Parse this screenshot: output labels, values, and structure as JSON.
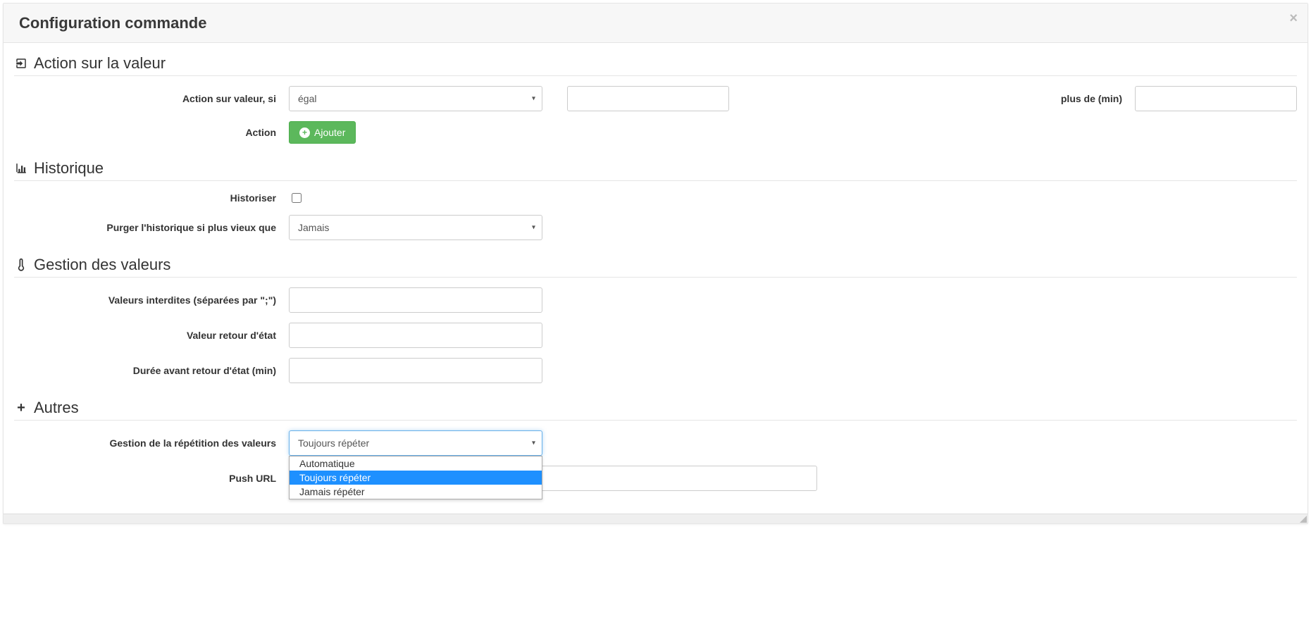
{
  "modal": {
    "title": "Configuration commande"
  },
  "sections": {
    "action_value": {
      "title": "Action sur la valeur",
      "label_action_si": "Action sur valeur, si",
      "select_value": "égal",
      "label_plus_de": "plus de (min)",
      "label_action": "Action",
      "add_button": "Ajouter"
    },
    "history": {
      "title": "Historique",
      "label_historiser": "Historiser",
      "label_purger": "Purger l'historique si plus vieux que",
      "select_purger": "Jamais"
    },
    "values": {
      "title": "Gestion des valeurs",
      "label_interdites": "Valeurs interdites (séparées par \";\")",
      "label_retour": "Valeur retour d'état",
      "label_duree": "Durée avant retour d'état (min)"
    },
    "autres": {
      "title": "Autres",
      "label_repetition": "Gestion de la répétition des valeurs",
      "select_repetition": "Toujours répéter",
      "options": [
        "Automatique",
        "Toujours répéter",
        "Jamais répéter"
      ],
      "label_push": "Push URL"
    }
  }
}
